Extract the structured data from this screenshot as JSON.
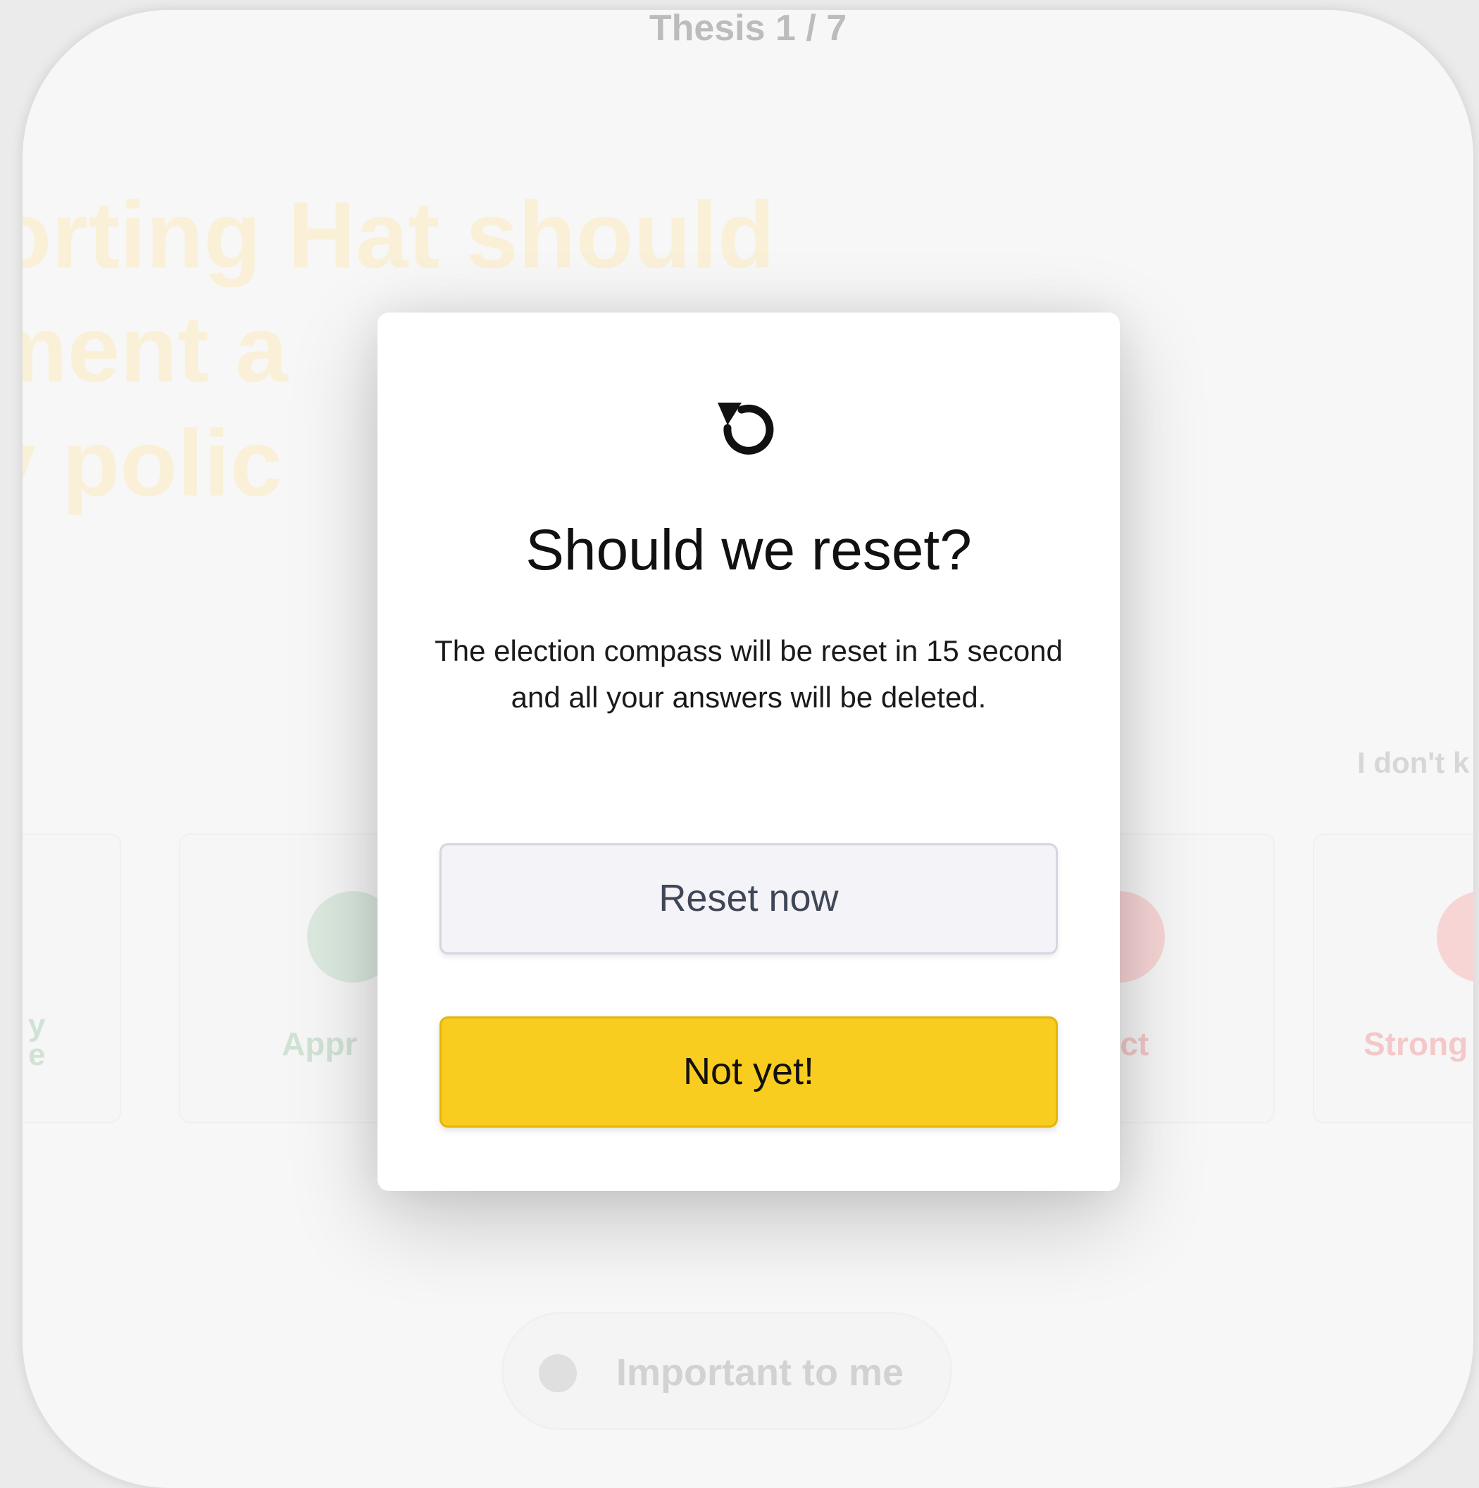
{
  "background": {
    "counter": "Thesis 1 / 7",
    "question_lines": [
      "Sorting Hat should",
      "ement a",
      "cy polic"
    ],
    "dont_know": "I don't k",
    "answers": [
      {
        "label": "y\ne",
        "color": "#bfd9c4"
      },
      {
        "label": "Appr",
        "color": "#bfd9c4"
      },
      {
        "label": "ject",
        "color": "#f2b3b3"
      },
      {
        "label": "Strong",
        "color": "#f2b3b3"
      }
    ],
    "important_label": "Important to me"
  },
  "modal": {
    "icon": "reset-icon",
    "title": "Should we reset?",
    "body": "The election compass will be reset in 15 second and all your answers will be deleted.",
    "reset_button": "Reset now",
    "not_yet_button": "Not yet!"
  },
  "colors": {
    "accent_yellow": "#f9cd1f",
    "agree_green": "#9fcdaa",
    "disagree_red": "#ee9999"
  }
}
